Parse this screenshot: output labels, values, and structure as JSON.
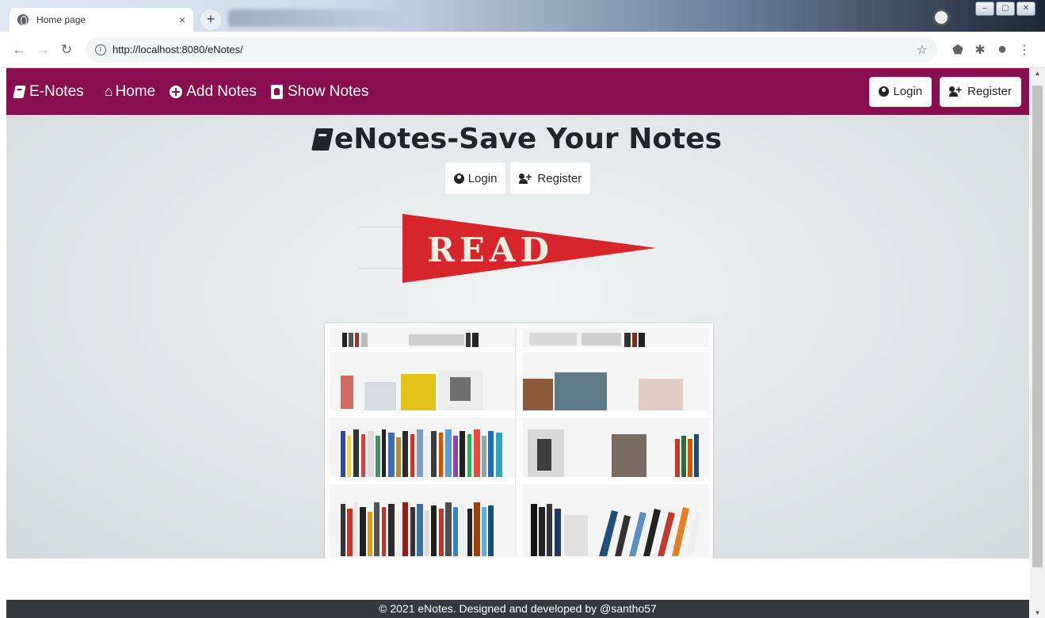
{
  "browser": {
    "tab_title": "Home page",
    "tab_close": "×",
    "new_tab": "+",
    "url": "http://localhost:8080/eNotes/",
    "window_buttons": [
      "–",
      "▢",
      "✕"
    ]
  },
  "navbar": {
    "brand": "E-Notes",
    "links": [
      "Home",
      "Add Notes",
      "Show Notes"
    ],
    "login_label": "Login",
    "register_label": "Register",
    "background": "#880e4f"
  },
  "hero": {
    "title": "eNotes-Save Your Notes",
    "login_label": "Login",
    "register_label": "Register",
    "pennant_text": "READ",
    "pennant_color": "#d7262b"
  },
  "footer": {
    "text": "© 2021 eNotes. Designed and developed by @santho57"
  },
  "icons": [
    "globe-icon",
    "book-icon",
    "home-icon",
    "plus-circle-icon",
    "id-card-icon",
    "user-circle-icon",
    "user-plus-icon"
  ]
}
